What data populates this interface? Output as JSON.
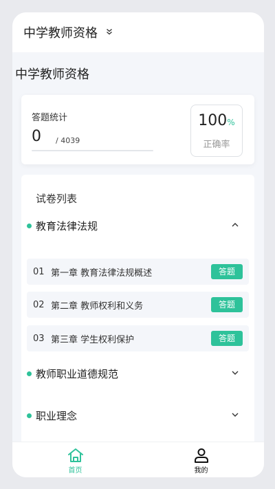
{
  "header": {
    "title": "中学教师资格",
    "chevron_icon": "double-chevron-down-icon"
  },
  "page_title": "中学教师资格",
  "stats": {
    "label": "答题统计",
    "answered": "0",
    "total": "/ 4039",
    "progress_fraction": 0,
    "accuracy_value": "100",
    "accuracy_unit": "%",
    "accuracy_label": "正确率"
  },
  "papers": {
    "title": "试卷列表",
    "sections": [
      {
        "name": "教育法律法规",
        "expanded": true,
        "icon": "chevron-up-icon",
        "items": [
          {
            "num": "01",
            "name": "第一章 教育法律法规概述",
            "button": "答题"
          },
          {
            "num": "02",
            "name": "第二章 教师权利和义务",
            "button": "答题"
          },
          {
            "num": "03",
            "name": "第三章 学生权利保护",
            "button": "答题"
          }
        ]
      },
      {
        "name": "教师职业道德规范",
        "expanded": false,
        "icon": "chevron-down-icon"
      },
      {
        "name": "职业理念",
        "expanded": false,
        "icon": "chevron-down-icon"
      }
    ]
  },
  "tabbar": {
    "home": {
      "label": "首页",
      "icon": "home-icon",
      "active": true
    },
    "mine": {
      "label": "我的",
      "icon": "person-icon",
      "active": false
    }
  },
  "colors": {
    "accent": "#2ec29a",
    "background": "#f4f6fa"
  }
}
